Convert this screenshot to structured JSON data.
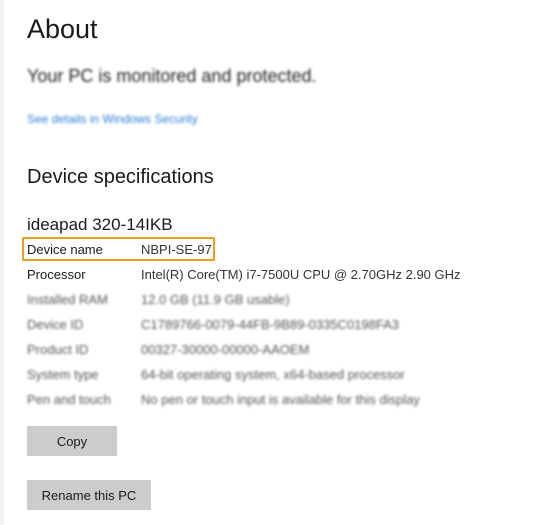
{
  "about": {
    "title": "About"
  },
  "security": {
    "status": "Your PC is monitored and protected.",
    "link": "See details in Windows Security"
  },
  "device_specs": {
    "heading": "Device specifications",
    "model": "ideapad 320-14IKB",
    "rows": [
      {
        "label": "Device name",
        "value": "NBPI-SE-97"
      },
      {
        "label": "Processor",
        "value": "Intel(R) Core(TM) i7-7500U CPU @ 2.70GHz   2.90 GHz"
      },
      {
        "label": "Installed RAM",
        "value": "12.0 GB (11.9 GB usable)"
      },
      {
        "label": "Device ID",
        "value": "C1789766-0079-44FB-9B89-0335C0198FA3"
      },
      {
        "label": "Product ID",
        "value": "00327-30000-00000-AAOEM"
      },
      {
        "label": "System type",
        "value": "64-bit operating system, x64-based processor"
      },
      {
        "label": "Pen and touch",
        "value": "No pen or touch input is available for this display"
      }
    ]
  },
  "buttons": {
    "copy": "Copy",
    "rename": "Rename this PC"
  },
  "colors": {
    "highlight": "#e8a21a",
    "link": "#2b7fd4",
    "button_bg": "#cccccc"
  }
}
